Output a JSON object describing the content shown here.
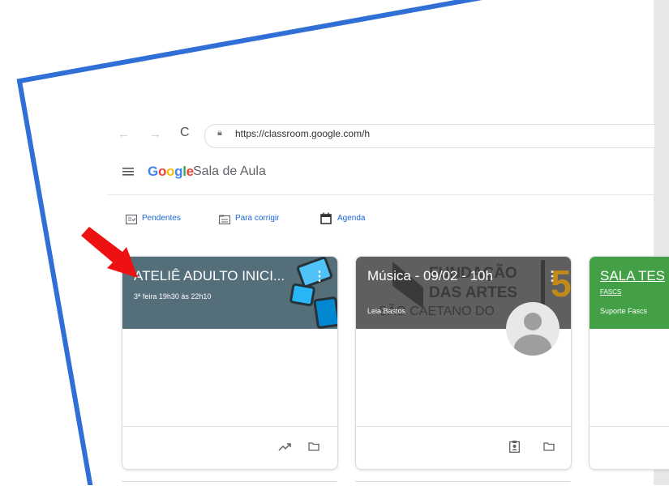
{
  "browser": {
    "url": "https://classroom.google.com/h"
  },
  "app": {
    "logo": "Google",
    "title": "Sala de Aula",
    "brand_colors": [
      "#4285f4",
      "#ea4335",
      "#fbbc05",
      "#4285f4",
      "#34a853",
      "#ea4335"
    ]
  },
  "toolbar": {
    "pending": "Pendentes",
    "to_grade": "Para corrigir",
    "agenda": "Agenda"
  },
  "cards": [
    {
      "title": "ATELIÊ ADULTO INICI...",
      "subtitle": "3ª feira 19h30 às 22h10",
      "color": "#546e7a"
    },
    {
      "title": "Música - 09/02 - 10h",
      "teacher": "Leia Bastos",
      "banner_text_1": "FUNDAÇÃO",
      "banner_text_2": "DAS ARTES",
      "banner_text_3": "SÃO CAETANO DO",
      "color": "#616161"
    },
    {
      "title": "SALA TES",
      "section": "FASCS",
      "subtitle": "Suporte Fascs",
      "color": "#43a047"
    }
  ],
  "annotation": {
    "frame_color": "#2f6fd6",
    "arrow_color": "#ee1111"
  }
}
